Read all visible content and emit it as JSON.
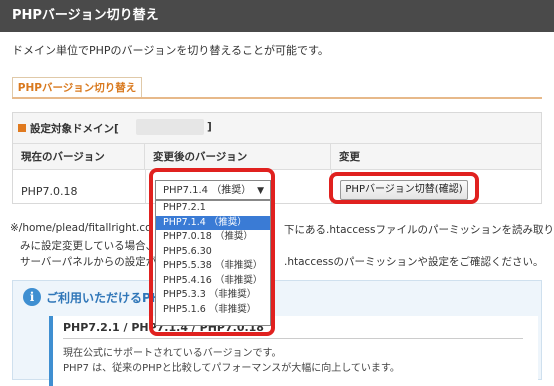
{
  "header": {
    "title": "PHPバージョン切り替え"
  },
  "description": "ドメイン単位でPHPのバージョンを切り替えることが可能です。",
  "tab": {
    "label": "PHPバージョン切り替え"
  },
  "panel": {
    "target_label": "設定対象ドメイン[",
    "target_close": "]",
    "columns": [
      "現在のバージョン",
      "変更後のバージョン",
      "変更"
    ],
    "current_version": "PHP7.0.18",
    "select": {
      "selected": "PHP7.1.4 （推奨）",
      "options": [
        "PHP7.2.1",
        "PHP7.1.4 （推奨）",
        "PHP7.0.18 （推奨）",
        "PHP5.6.30",
        "PHP5.5.38 （非推奨）",
        "PHP5.4.16 （非推奨）",
        "PHP5.3.3 （非推奨）",
        "PHP5.1.6 （非推奨）"
      ],
      "highlighted_index": 1
    },
    "change_button": "PHPバージョン切替(確認)"
  },
  "notes": {
    "line1a": "※/home/plead/fitallright.co",
    "line1b": "下にある.htaccessファイルのパーミッションを読み取りの",
    "line2a": "みに設定変更している場合、",
    "line3a": "サーバーパネルからの設定が",
    "line3b": ".htaccessのパーミッションや設定をご確認ください。"
  },
  "info": {
    "icon": "i",
    "title": "ご利用いただけるPHP",
    "inner_heading": "PHP7.2.1 / PHP7.1.4 / PHP7.0.18",
    "inner_line1": "現在公式にサポートされているバージョンです。",
    "inner_line2": "PHP7 は、従来のPHPと比較してパフォーマンスが大幅に向上しています。"
  },
  "colors": {
    "accent": "#e07a1f",
    "highlight": "#e0211f",
    "info": "#3f8fd1"
  }
}
